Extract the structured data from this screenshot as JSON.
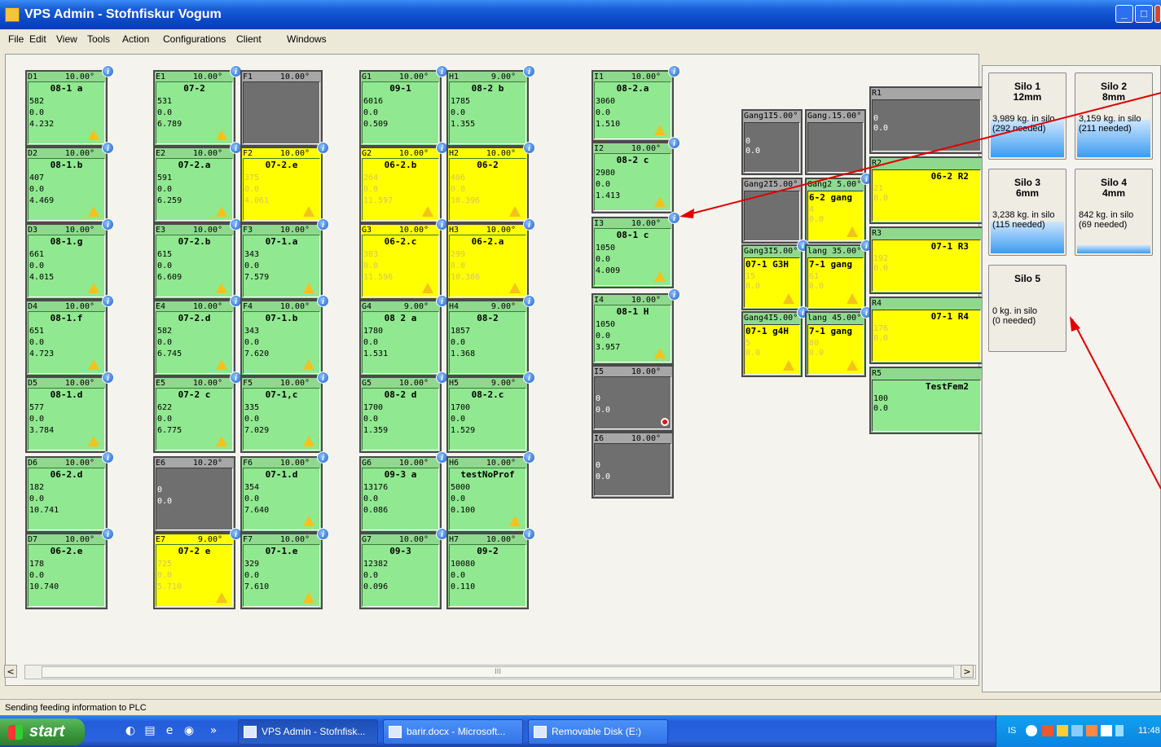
{
  "window": {
    "title": "VPS Admin - Stofnfiskur Vogum",
    "min_label": "_",
    "max_label": "□",
    "close_label": "x"
  },
  "menu": [
    "File",
    "Edit",
    "View",
    "Tools",
    "Action",
    "Configurations",
    "Client",
    "Windows"
  ],
  "tanks": [
    {
      "id": "D1",
      "temp": "10.00°",
      "name": "08-1 a",
      "v1": "582",
      "v2": "0.0",
      "v3": "4.232",
      "status": "green",
      "warn": true
    },
    {
      "id": "D2",
      "temp": "10.00°",
      "name": "08-1.b",
      "v1": "407",
      "v2": "0.0",
      "v3": "4.469",
      "status": "green",
      "warn": true
    },
    {
      "id": "D3",
      "temp": "10.00°",
      "name": "08-1.g",
      "v1": "661",
      "v2": "0.0",
      "v3": "4.015",
      "status": "green",
      "warn": true
    },
    {
      "id": "D4",
      "temp": "10.00°",
      "name": "08-1.f",
      "v1": "651",
      "v2": "0.0",
      "v3": "4.723",
      "status": "green",
      "warn": true
    },
    {
      "id": "D5",
      "temp": "10.00°",
      "name": "08-1.d",
      "v1": "577",
      "v2": "0.0",
      "v3": "3.784",
      "status": "green",
      "warn": true
    },
    {
      "id": "D6",
      "temp": "10.00°",
      "name": "06-2.d",
      "v1": "182",
      "v2": "0.0",
      "v3": "10.741",
      "status": "green",
      "warn": false
    },
    {
      "id": "D7",
      "temp": "10.00°",
      "name": "06-2.e",
      "v1": "178",
      "v2": "0.0",
      "v3": "10.740",
      "status": "green",
      "warn": false
    },
    {
      "id": "E1",
      "temp": "10.00°",
      "name": "07-2",
      "v1": "531",
      "v2": "0.0",
      "v3": "6.789",
      "status": "green",
      "warn": true
    },
    {
      "id": "E2",
      "temp": "10.00°",
      "name": "07-2.a",
      "v1": "591",
      "v2": "0.0",
      "v3": "6.259",
      "status": "green",
      "warn": true
    },
    {
      "id": "E3",
      "temp": "10.00°",
      "name": "07-2.b",
      "v1": "615",
      "v2": "0.0",
      "v3": "6.609",
      "status": "green",
      "warn": true
    },
    {
      "id": "E4",
      "temp": "10.00°",
      "name": "07-2.d",
      "v1": "582",
      "v2": "0.0",
      "v3": "6.745",
      "status": "green",
      "warn": true
    },
    {
      "id": "E5",
      "temp": "10.00°",
      "name": "07-2 c",
      "v1": "622",
      "v2": "0.0",
      "v3": "6.775",
      "status": "green",
      "warn": true
    },
    {
      "id": "E6",
      "temp": "10.20°",
      "name": "",
      "v1": "0",
      "v2": "0.0",
      "v3": "",
      "status": "grey",
      "warn": false
    },
    {
      "id": "E7",
      "temp": "9.00°",
      "name": "07-2 e",
      "v1": "725",
      "v2": "0.0",
      "v3": "5.710",
      "status": "yellow",
      "warn": true
    },
    {
      "id": "F1",
      "temp": "10.00°",
      "name": "",
      "v1": "",
      "v2": "",
      "v3": "",
      "status": "grey",
      "warn": false
    },
    {
      "id": "F2",
      "temp": "10.00°",
      "name": "07-2.e",
      "v1": "375",
      "v2": "0.0",
      "v3": "4.061",
      "status": "yellow",
      "warn": true
    },
    {
      "id": "F3",
      "temp": "10.00°",
      "name": "07-1.a",
      "v1": "343",
      "v2": "0.0",
      "v3": "7.579",
      "status": "green",
      "warn": true
    },
    {
      "id": "F4",
      "temp": "10.00°",
      "name": "07-1.b",
      "v1": "343",
      "v2": "0.0",
      "v3": "7.620",
      "status": "green",
      "warn": true
    },
    {
      "id": "F5",
      "temp": "10.00°",
      "name": "07-1,c",
      "v1": "335",
      "v2": "0.0",
      "v3": "7.029",
      "status": "green",
      "warn": true
    },
    {
      "id": "F6",
      "temp": "10.00°",
      "name": "07-1.d",
      "v1": "354",
      "v2": "0.0",
      "v3": "7.640",
      "status": "green",
      "warn": true
    },
    {
      "id": "F7",
      "temp": "10.00°",
      "name": "07-1.e",
      "v1": "329",
      "v2": "0.0",
      "v3": "7.610",
      "status": "green",
      "warn": true
    },
    {
      "id": "G1",
      "temp": "10.00°",
      "name": "09-1",
      "v1": "6016",
      "v2": "0.0",
      "v3": "0.509",
      "status": "green",
      "warn": false
    },
    {
      "id": "G2",
      "temp": "10.00°",
      "name": "06-2.b",
      "v1": "264",
      "v2": "0.0",
      "v3": "11.597",
      "status": "yellow",
      "warn": true
    },
    {
      "id": "G3",
      "temp": "10.00°",
      "name": "06-2.c",
      "v1": "303",
      "v2": "0.0",
      "v3": "11.596",
      "status": "yellow",
      "warn": true
    },
    {
      "id": "G4",
      "temp": "9.00°",
      "name": "08 2 a",
      "v1": "1780",
      "v2": "0.0",
      "v3": "1.531",
      "status": "green",
      "warn": false
    },
    {
      "id": "G5",
      "temp": "10.00°",
      "name": "08-2 d",
      "v1": "1700",
      "v2": "0.0",
      "v3": "1.359",
      "status": "green",
      "warn": false
    },
    {
      "id": "G6",
      "temp": "10.00°",
      "name": "09-3 a",
      "v1": "13176",
      "v2": "0.0",
      "v3": "0.086",
      "status": "green",
      "warn": false
    },
    {
      "id": "G7",
      "temp": "10.00°",
      "name": "09-3",
      "v1": "12382",
      "v2": "0.0",
      "v3": "0.096",
      "status": "green",
      "warn": false
    },
    {
      "id": "H1",
      "temp": "9.00°",
      "name": "08-2 b",
      "v1": "1785",
      "v2": "0.0",
      "v3": "1.355",
      "status": "green",
      "warn": false
    },
    {
      "id": "H2",
      "temp": "10.00°",
      "name": "06-2",
      "v1": "406",
      "v2": "0.0",
      "v3": "10.396",
      "status": "yellow",
      "warn": true
    },
    {
      "id": "H3",
      "temp": "10.00°",
      "name": "06-2.a",
      "v1": "299",
      "v2": "0.0",
      "v3": "10.386",
      "status": "yellow",
      "warn": true
    },
    {
      "id": "H4",
      "temp": "9.00°",
      "name": "08-2",
      "v1": "1857",
      "v2": "0.0",
      "v3": "1.368",
      "status": "green",
      "warn": false
    },
    {
      "id": "H5",
      "temp": "9.00°",
      "name": "08-2.c",
      "v1": "1700",
      "v2": "0.0",
      "v3": "1.529",
      "status": "green",
      "warn": false
    },
    {
      "id": "H6",
      "temp": "10.00°",
      "name": "testNoProf",
      "v1": "5000",
      "v2": "0.0",
      "v3": "0.100",
      "status": "green",
      "warn": true
    },
    {
      "id": "H7",
      "temp": "10.00°",
      "name": "09-2",
      "v1": "10080",
      "v2": "0.0",
      "v3": "0.110",
      "status": "green",
      "warn": false
    },
    {
      "id": "I1",
      "temp": "10.00°",
      "name": "08-2.a",
      "v1": "3060",
      "v2": "0.0",
      "v3": "1.510",
      "status": "green",
      "warn": true
    },
    {
      "id": "I2",
      "temp": "10.00°",
      "name": "08-2 c",
      "v1": "2980",
      "v2": "0.0",
      "v3": "1.413",
      "status": "green",
      "warn": true
    },
    {
      "id": "I3",
      "temp": "10.00°",
      "name": "08-1 c",
      "v1": "1050",
      "v2": "0.0",
      "v3": "4.009",
      "status": "green",
      "warn": true
    },
    {
      "id": "I4",
      "temp": "10.00°",
      "name": "08-1 H",
      "v1": "1050",
      "v2": "0.0",
      "v3": "3.957",
      "status": "green",
      "warn": true
    },
    {
      "id": "I5",
      "temp": "10.00°",
      "name": "",
      "v1": "0",
      "v2": "0.0",
      "v3": "",
      "status": "grey",
      "warn": false
    },
    {
      "id": "I6",
      "temp": "10.00°",
      "name": "",
      "v1": "0",
      "v2": "0.0",
      "v3": "",
      "status": "grey",
      "warn": false
    }
  ],
  "gangs": [
    {
      "id": "Gang1",
      "header": "Gang1I5.00°",
      "name": "",
      "v1": "0",
      "v2": "0.0",
      "status": "grey"
    },
    {
      "id": "Gang1b",
      "header": "Gang.15.00°",
      "name": "",
      "v1": "",
      "v2": "",
      "status": "grey"
    },
    {
      "id": "Gang2a",
      "header": "Gang2I5.00°",
      "name": "",
      "v1": "",
      "v2": "",
      "status": "grey"
    },
    {
      "id": "Gang2",
      "header": "Gang2 5.00°",
      "name": "6-2 gang",
      "v1": "4",
      "v2": "0.0",
      "status": "green"
    },
    {
      "id": "Gang3a",
      "header": "Gang3I5.00°",
      "name": "07-1 G3H",
      "v1": "15",
      "v2": "0.0",
      "status": "green"
    },
    {
      "id": "Gang3",
      "header": "lang 35.00°",
      "name": "7-1 gang",
      "v1": "61",
      "v2": "0.0",
      "status": "green"
    },
    {
      "id": "Gang4a",
      "header": "Gang4I5.00°",
      "name": "07-1 g4H",
      "v1": "5",
      "v2": "0.0",
      "status": "green"
    },
    {
      "id": "Gang4",
      "header": "lang 45.00°",
      "name": "7-1 gang",
      "v1": "80",
      "v2": "0.0",
      "status": "green"
    }
  ],
  "rtanks": [
    {
      "id": "R1",
      "name": "",
      "v1": "0",
      "v2": "0.0",
      "status": "grey"
    },
    {
      "id": "R2",
      "name": "06-2 R2",
      "v1": "21",
      "v2": "0.0",
      "status": "yellow"
    },
    {
      "id": "R3",
      "name": "07-1 R3",
      "v1": "192",
      "v2": "0.0",
      "status": "yellow"
    },
    {
      "id": "R4",
      "name": "07-1 R4",
      "v1": "176",
      "v2": "0.0",
      "status": "yellow"
    },
    {
      "id": "R5",
      "name": "TestFem2",
      "v1": "100",
      "v2": "0.0",
      "status": "green"
    }
  ],
  "silos": [
    {
      "name": "Silo 1",
      "size": "12mm",
      "kg": "3,989 kg. in silo",
      "needed": "(292 needed)",
      "fill": 0.45
    },
    {
      "name": "Silo 2",
      "size": "8mm",
      "kg": "3,159 kg. in silo",
      "needed": "(211 needed)",
      "fill": 0.45
    },
    {
      "name": "Silo 3",
      "size": "6mm",
      "kg": "3,238 kg. in silo",
      "needed": "(115 needed)",
      "fill": 0.38
    },
    {
      "name": "Silo 4",
      "size": "4mm",
      "kg": "842 kg. in silo",
      "needed": "(69 needed)",
      "fill": 0.1
    },
    {
      "name": "Silo 5",
      "size": "",
      "kg": "0 kg. in silo",
      "needed": "(0 needed)",
      "fill": 0
    }
  ],
  "status_text": "Sending feeding information to PLC",
  "scroll": {
    "left": "<",
    "right": ">",
    "thumb": "III"
  },
  "taskbar": {
    "start": "start",
    "buttons": [
      "VPS Admin - Stofnfisk...",
      "barir.docx - Microsoft...",
      "Removable Disk (E:)"
    ],
    "lang": "IS",
    "clock": "11:48",
    "overflow": "»"
  },
  "colors": {
    "green": "#8fd98f",
    "yellow": "#ffff00",
    "grey": "#a7a7a7",
    "arrow": "#e00000"
  }
}
